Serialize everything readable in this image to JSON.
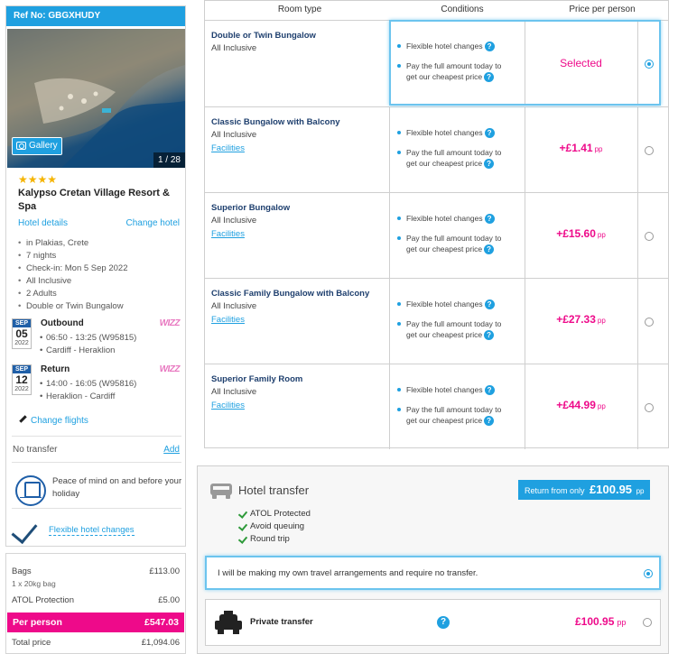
{
  "sidebar": {
    "ref_label": "Ref No:",
    "ref_value": "GBGXHUDY",
    "gallery_label": "Gallery",
    "photo_counter": "1 / 28",
    "stars": "★★★★",
    "hotel_name": "Kalypso Cretan Village Resort & Spa",
    "hotel_details_link": "Hotel details",
    "change_hotel_link": "Change hotel",
    "facts": [
      "in Plakias, Crete",
      "7 nights",
      "Check-in: Mon 5 Sep 2022",
      "All Inclusive",
      "2 Adults",
      "Double or Twin Bungalow"
    ],
    "outbound": {
      "month": "SEP",
      "day": "05",
      "year": "2022",
      "title": "Outbound",
      "times": "06:50 - 13:25 (W95815)",
      "route": "Cardiff - Heraklion",
      "airline": "WIZZ"
    },
    "return": {
      "month": "SEP",
      "day": "12",
      "year": "2022",
      "title": "Return",
      "times": "14:00 - 16:05 (W95816)",
      "route": "Heraklion - Cardiff",
      "airline": "WIZZ"
    },
    "change_flights_link": "Change flights",
    "no_transfer": "No transfer",
    "add_link": "Add",
    "peace_of_mind": "Peace of mind on and before your holiday",
    "flexible_changes_link": "Flexible hotel changes"
  },
  "price_summary": {
    "bags_label": "Bags",
    "bags_value": "£113.00",
    "bags_sub": "1 x 20kg bag",
    "atol_label": "ATOL Protection",
    "atol_value": "£5.00",
    "per_person_label": "Per person",
    "per_person_value": "£547.03",
    "total_label": "Total price",
    "total_value": "£1,094.06"
  },
  "room_table": {
    "headers": {
      "room_type": "Room type",
      "conditions": "Conditions",
      "price": "Price per person"
    },
    "condition_1": "Flexible hotel changes",
    "condition_2a": "Pay the full amount today to",
    "condition_2b": "get our cheapest price",
    "facilities_label": "Facilities",
    "pp_label": "pp",
    "selected_label": "Selected",
    "rooms": [
      {
        "name": "Double or Twin Bungalow",
        "board": "All Inclusive",
        "price": "",
        "selected": true
      },
      {
        "name": "Classic Bungalow with Balcony",
        "board": "All Inclusive",
        "price": "+£1.41",
        "selected": false
      },
      {
        "name": "Superior Bungalow",
        "board": "All Inclusive",
        "price": "+£15.60",
        "selected": false
      },
      {
        "name": "Classic Family Bungalow with Balcony",
        "board": "All Inclusive",
        "price": "+£27.33",
        "selected": false
      },
      {
        "name": "Superior Family Room",
        "board": "All Inclusive",
        "price": "+£44.99",
        "selected": false
      }
    ]
  },
  "transfer": {
    "title": "Hotel transfer",
    "badge_prefix": "Return from only",
    "badge_price": "£100.95",
    "badge_pp": "pp",
    "features": [
      "ATOL Protected",
      "Avoid queuing",
      "Round trip"
    ],
    "own_arrangements": "I will be making my own travel arrangements and require no transfer.",
    "private_label": "Private transfer",
    "private_price": "£100.95",
    "private_pp": "pp"
  },
  "colors": {
    "accent": "#1fa0e0",
    "price_pink": "#ee0a8a",
    "navy": "#1e3f6e"
  }
}
